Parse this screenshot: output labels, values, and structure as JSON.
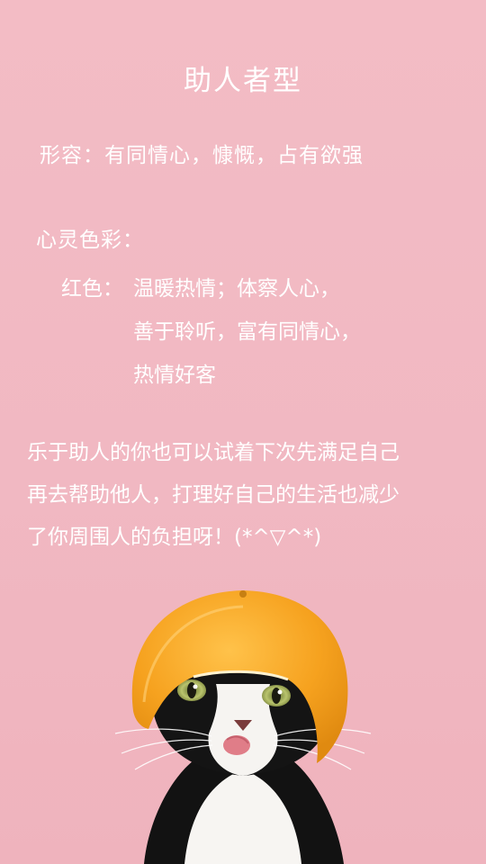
{
  "title": "助人者型",
  "description": "形容：有同情心，慷慨，占有欲强",
  "colors": {
    "heading": "心灵色彩：",
    "red_label": "红色：",
    "red_lines": [
      "温暖热情；体察人心，",
      "善于聆听，富有同情心，",
      "热情好客"
    ]
  },
  "message": [
    "乐于助人的你也可以试着下次先满足自己",
    "再去帮助他人，打理好自己的生活也减少",
    "了你周围人的负担呀！(*^▽^*)"
  ],
  "palette": {
    "background": "#f2b9c3",
    "text": "#ffffff",
    "orange": "#f5a623"
  }
}
